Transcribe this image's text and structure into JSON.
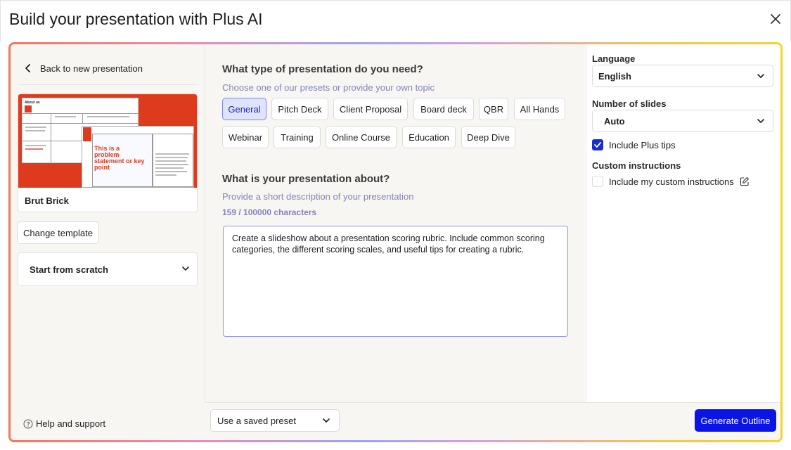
{
  "header": {
    "title": "Build your presentation with Plus AI"
  },
  "left": {
    "back_label": "Back to new presentation",
    "template": {
      "name": "Brut Brick",
      "thumb_about": "About us",
      "thumb_headline_1": "This is a",
      "thumb_headline_2": "problem",
      "thumb_headline_3": "statement or key",
      "thumb_headline_4": "point"
    },
    "change_template_label": "Change template",
    "start_from_scratch_label": "Start from scratch",
    "help_label": "Help and support"
  },
  "main": {
    "type_question": "What type of presentation do you need?",
    "type_hint": "Choose one of our presets or provide your own topic",
    "presets": [
      {
        "label": "General",
        "active": true
      },
      {
        "label": "Pitch Deck",
        "active": false
      },
      {
        "label": "Client Proposal",
        "active": false
      },
      {
        "label": "Board deck",
        "active": false
      },
      {
        "label": "QBR",
        "active": false
      },
      {
        "label": "All Hands",
        "active": false
      },
      {
        "label": "Webinar",
        "active": false
      },
      {
        "label": "Training",
        "active": false
      },
      {
        "label": "Online Course",
        "active": false
      },
      {
        "label": "Education",
        "active": false
      },
      {
        "label": "Deep Dive",
        "active": false
      }
    ],
    "about_question": "What is your presentation about?",
    "about_hint": "Provide a short description of your presentation",
    "char_count": "159 / 100000 characters",
    "description": "Create a slideshow about a presentation scoring rubric. Include common scoring categories, the different scoring scales, and useful tips for creating a rubric."
  },
  "bottom": {
    "saved_preset_label": "Use a saved preset",
    "generate_label": "Generate Outline"
  },
  "settings": {
    "language_label": "Language",
    "language_value": "English",
    "slides_label": "Number of slides",
    "slides_value": "Auto",
    "plus_tips_label": "Include Plus tips",
    "plus_tips_checked": true,
    "custom_label": "Custom instructions",
    "custom_check_label": "Include my custom instructions",
    "custom_checked": false
  },
  "colors": {
    "accent": "#0a14e6",
    "chip_active_bg": "#dfe3fc",
    "hint_text": "#8684b8",
    "template_red": "#de3b1e"
  }
}
